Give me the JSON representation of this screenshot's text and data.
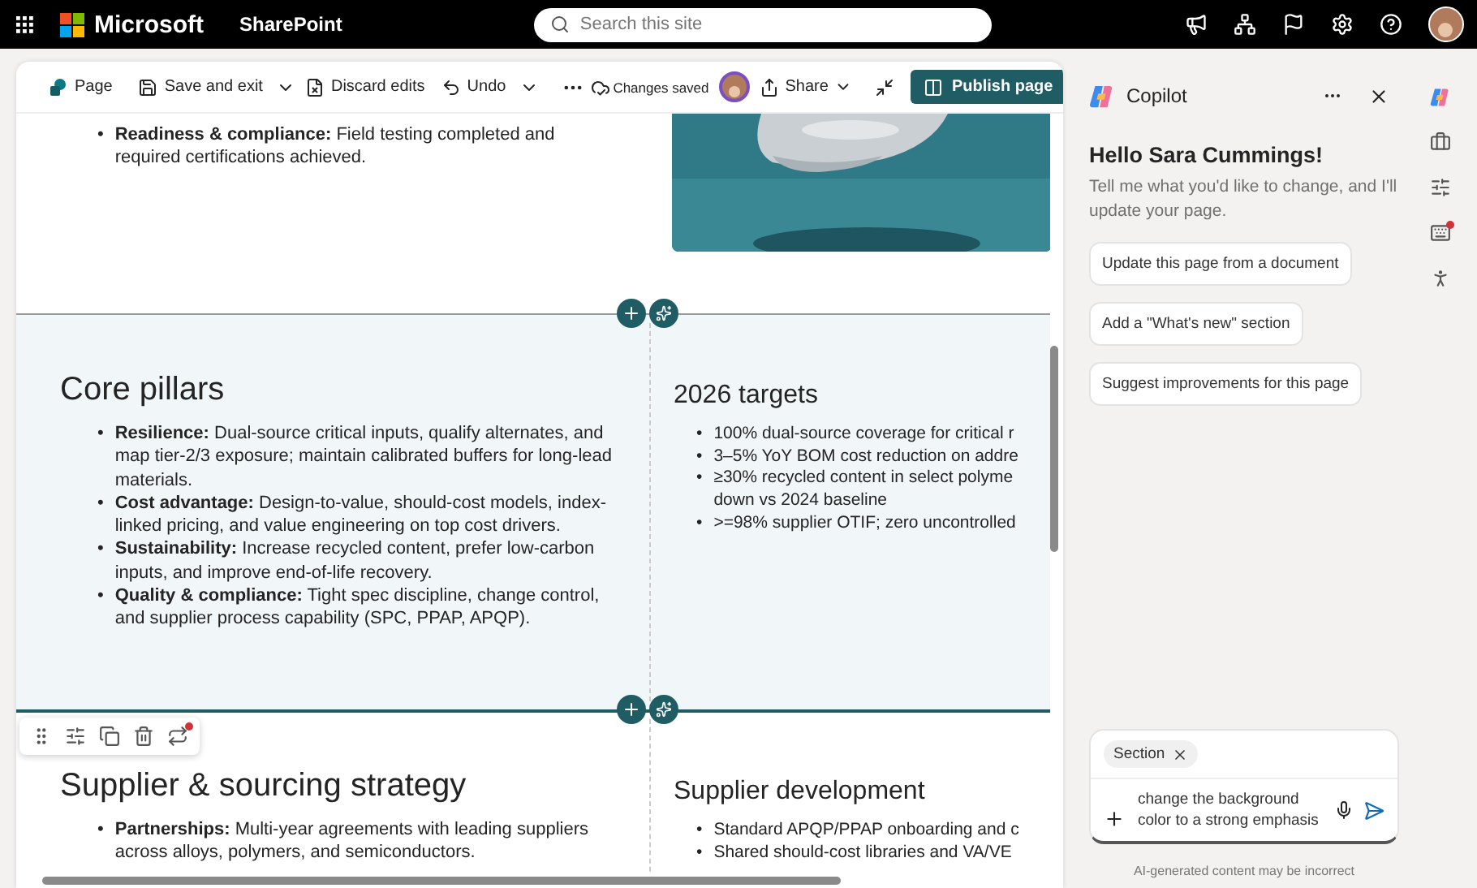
{
  "top_bar": {
    "brand": "Microsoft",
    "app": "SharePoint",
    "search": {
      "placeholder": "Search this site"
    }
  },
  "toolbar": {
    "page": "Page",
    "save": "Save and exit",
    "discard": "Discard edits",
    "undo": "Undo",
    "status": "Changes saved",
    "share": "Share",
    "publish": "Publish page"
  },
  "sections": [
    {
      "shaded": false,
      "selected": false,
      "columns": [
        {
          "kind": "text",
          "marker": "•",
          "bullets": [
            "**Readiness & compliance:** Field testing completed and required certifications achieved."
          ]
        },
        {
          "kind": "picture"
        }
      ]
    },
    {
      "shaded": true,
      "selected": false,
      "columns": [
        {
          "kind": "text",
          "marker": "•",
          "heading": "Core pillars",
          "bullets": [
            "**Resilience:** Dual-source critical inputs, qualify alternates, and map tier-2/3 exposure; maintain calibrated buffers for long-lead materials.",
            "**Cost advantage:** Design-to-value, should-cost models, index-linked pricing, and value engineering on top cost drivers.",
            "**Sustainability:** Increase recycled content, prefer low-carbon inputs, and improve end-of-life recovery.",
            "**Quality & compliance:** Tight spec discipline, change control, and supplier process capability (SPC, PPAP, APQP)."
          ]
        },
        {
          "kind": "clipped",
          "marker": "•",
          "heading": "2026 targets",
          "bullets": [
            "100% dual-source coverage for critical r",
            "3–5% YoY BOM cost reduction on addre",
            "≥30% recycled content in select polyme\ndown vs 2024 baseline",
            ">=98% supplier OTIF; zero uncontrolled"
          ]
        }
      ]
    },
    {
      "shaded": false,
      "selected": true,
      "columns": [
        {
          "kind": "text",
          "marker": "•",
          "heading": "Supplier & sourcing strategy",
          "bullets": [
            "**Partnerships:** Multi-year agreements with leading suppliers across alloys, polymers, and semiconductors."
          ]
        },
        {
          "kind": "clipped",
          "marker": "•",
          "heading": "Supplier development",
          "bullets": [
            "Standard APQP/PPAP onboarding and c",
            "Shared should-cost libraries and VA/VE"
          ]
        }
      ]
    }
  ],
  "copilot": {
    "title": "Copilot",
    "greeting": "Hello Sara Cummings!",
    "intro": "Tell me what you'd like to change, and I'll update your page.",
    "suggestions": [
      "Update this page from a document",
      "Add a \"What's new\" section",
      "Suggest improvements for this page"
    ],
    "context_chip": "Section",
    "prompt": "change the background color to a strong emphasis",
    "disclaimer": "AI-generated content may be incorrect"
  }
}
